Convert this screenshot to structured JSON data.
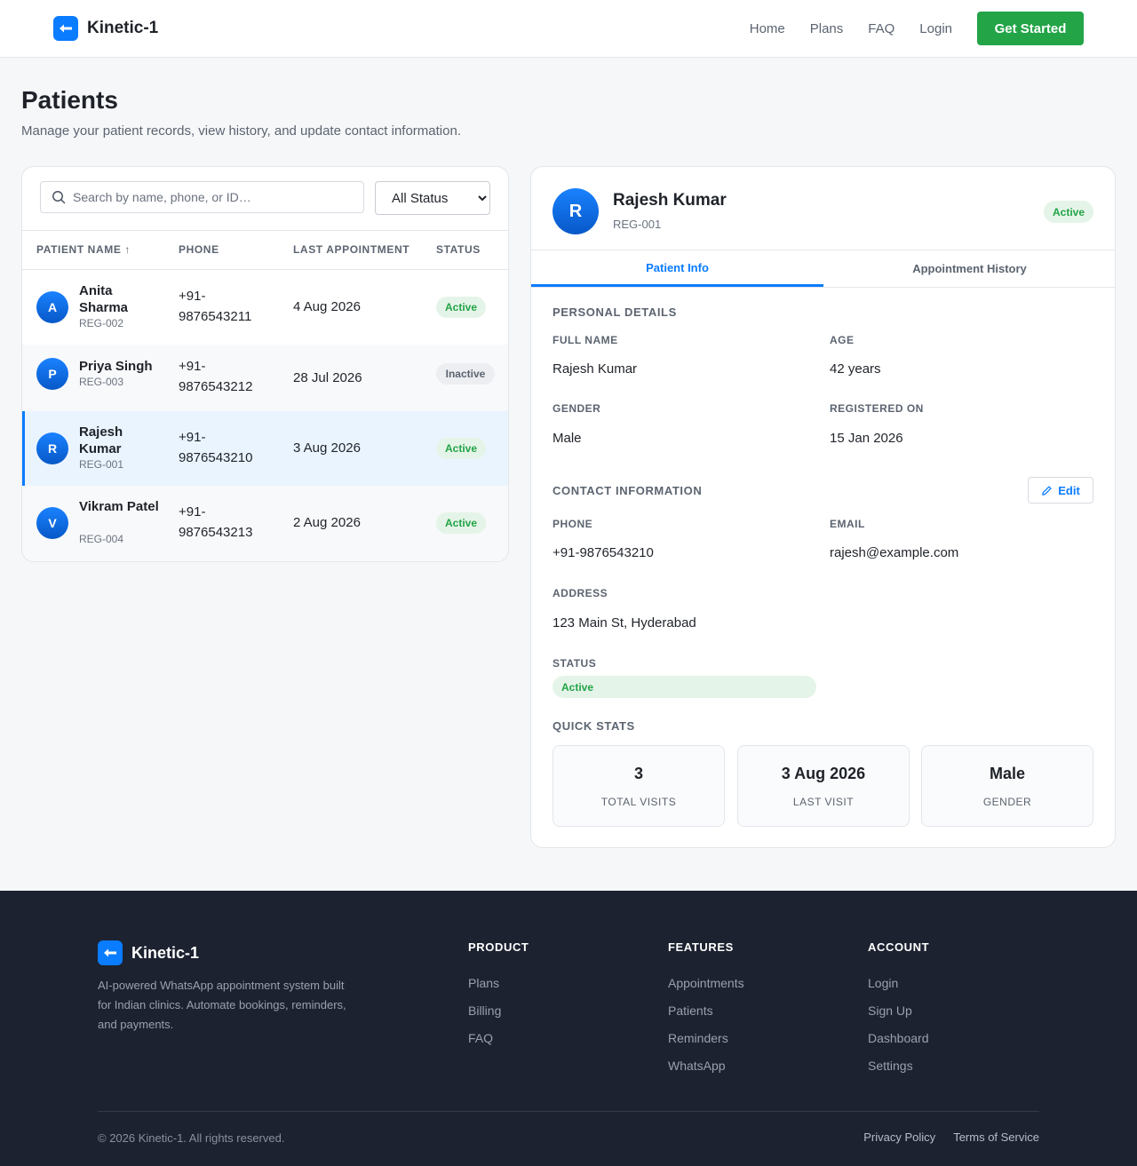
{
  "header": {
    "brand": "Kinetic-1",
    "nav": [
      "Home",
      "Plans",
      "FAQ",
      "Login"
    ],
    "cta": "Get Started"
  },
  "page": {
    "title": "Patients",
    "subtitle": "Manage your patient records, view history, and update contact information."
  },
  "list": {
    "search_placeholder": "Search by name, phone, or ID…",
    "status_filter": "All Status",
    "columns": [
      "PATIENT NAME ↑",
      "PHONE",
      "LAST APPOINTMENT",
      "STATUS"
    ],
    "rows": [
      {
        "initial": "A",
        "name": "Anita Sharma",
        "id": "REG-002",
        "phone": "+91-9876543211",
        "last": "4 Aug 2026",
        "status": "Active"
      },
      {
        "initial": "P",
        "name": "Priya Singh",
        "id": "REG-003",
        "phone": "+91-9876543212",
        "last": "28 Jul 2026",
        "status": "Inactive"
      },
      {
        "initial": "R",
        "name": "Rajesh Kumar",
        "id": "REG-001",
        "phone": "+91-9876543210",
        "last": "3 Aug 2026",
        "status": "Active"
      },
      {
        "initial": "V",
        "name": "Vikram Patel",
        "id": "REG-004",
        "phone": "+91-9876543213",
        "last": "2 Aug 2026",
        "status": "Active"
      }
    ]
  },
  "detail": {
    "initial": "R",
    "name": "Rajesh Kumar",
    "id": "REG-001",
    "status": "Active",
    "tabs": [
      "Patient Info",
      "Appointment History"
    ],
    "personal_heading": "PERSONAL DETAILS",
    "full_name_label": "FULL NAME",
    "full_name": "Rajesh Kumar",
    "age_label": "AGE",
    "age": "42 years",
    "gender_label": "GENDER",
    "gender": "Male",
    "registered_label": "REGISTERED ON",
    "registered": "15 Jan 2026",
    "contact_heading": "CONTACT INFORMATION",
    "edit_label": "Edit",
    "phone_label": "PHONE",
    "phone": "+91-9876543210",
    "email_label": "EMAIL",
    "email": "rajesh@example.com",
    "address_label": "ADDRESS",
    "address": "123 Main St, Hyderabad",
    "status_label": "STATUS",
    "status_value": "Active",
    "stats_heading": "QUICK STATS",
    "stats": [
      {
        "value": "3",
        "label": "TOTAL VISITS"
      },
      {
        "value": "3 Aug 2026",
        "label": "LAST VISIT"
      },
      {
        "value": "Male",
        "label": "GENDER"
      }
    ]
  },
  "footer": {
    "brand": "Kinetic-1",
    "description": "AI-powered WhatsApp appointment system built for Indian clinics. Automate bookings, reminders, and payments.",
    "columns": [
      {
        "heading": "PRODUCT",
        "links": [
          "Plans",
          "Billing",
          "FAQ"
        ]
      },
      {
        "heading": "FEATURES",
        "links": [
          "Appointments",
          "Patients",
          "Reminders",
          "WhatsApp"
        ]
      },
      {
        "heading": "ACCOUNT",
        "links": [
          "Login",
          "Sign Up",
          "Dashboard",
          "Settings"
        ]
      }
    ],
    "copyright": "© 2026 Kinetic-1. All rights reserved.",
    "legal": [
      "Privacy Policy",
      "Terms of Service"
    ]
  },
  "colors": {
    "accent": "#0a7cff",
    "cta": "#22a447",
    "footer_bg": "#1c2230"
  }
}
